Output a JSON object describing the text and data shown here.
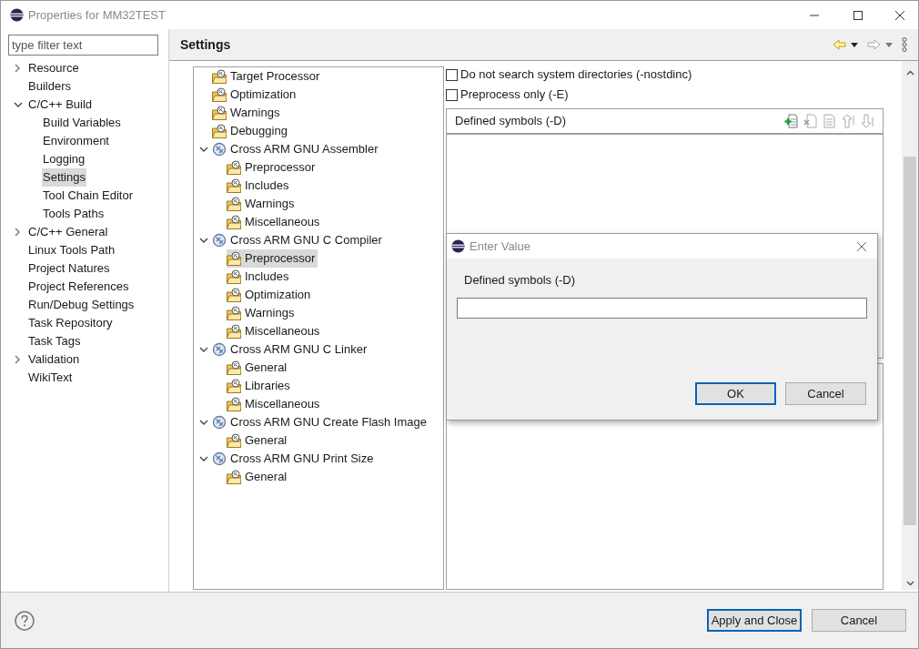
{
  "window": {
    "title": "Properties for MM32TEST"
  },
  "filter": {
    "placeholder": "type filter text"
  },
  "nav": [
    {
      "label": "Resource",
      "expanded": false,
      "selected": false
    },
    {
      "label": "Builders",
      "selected": false
    },
    {
      "label": "C/C++ Build",
      "expanded": true,
      "selected": false,
      "children": [
        {
          "label": "Build Variables",
          "selected": false
        },
        {
          "label": "Environment",
          "selected": false
        },
        {
          "label": "Logging",
          "selected": false
        },
        {
          "label": "Settings",
          "selected": true
        },
        {
          "label": "Tool Chain Editor",
          "selected": false
        },
        {
          "label": "Tools Paths",
          "selected": false
        }
      ]
    },
    {
      "label": "C/C++ General",
      "expanded": false,
      "selected": false
    },
    {
      "label": "Linux Tools Path",
      "selected": false
    },
    {
      "label": "Project Natures",
      "selected": false
    },
    {
      "label": "Project References",
      "selected": false
    },
    {
      "label": "Run/Debug Settings",
      "selected": false
    },
    {
      "label": "Task Repository",
      "selected": false
    },
    {
      "label": "Task Tags",
      "selected": false
    },
    {
      "label": "Validation",
      "expanded": false,
      "selected": false
    },
    {
      "label": "WikiText",
      "selected": false
    }
  ],
  "page_title": "Settings",
  "tool_tree": [
    {
      "label": "Target Processor",
      "kind": "category",
      "selected": false
    },
    {
      "label": "Optimization",
      "kind": "category",
      "selected": false
    },
    {
      "label": "Warnings",
      "kind": "category",
      "selected": false
    },
    {
      "label": "Debugging",
      "kind": "category",
      "selected": false
    },
    {
      "label": "Cross ARM GNU Assembler",
      "kind": "tool",
      "expanded": true,
      "selected": false,
      "children": [
        {
          "label": "Preprocessor",
          "kind": "category",
          "selected": false
        },
        {
          "label": "Includes",
          "kind": "category",
          "selected": false
        },
        {
          "label": "Warnings",
          "kind": "category",
          "selected": false
        },
        {
          "label": "Miscellaneous",
          "kind": "category",
          "selected": false
        }
      ]
    },
    {
      "label": "Cross ARM GNU C Compiler",
      "kind": "tool",
      "expanded": true,
      "selected": false,
      "children": [
        {
          "label": "Preprocessor",
          "kind": "category",
          "selected": true
        },
        {
          "label": "Includes",
          "kind": "category",
          "selected": false
        },
        {
          "label": "Optimization",
          "kind": "category",
          "selected": false
        },
        {
          "label": "Warnings",
          "kind": "category",
          "selected": false
        },
        {
          "label": "Miscellaneous",
          "kind": "category",
          "selected": false
        }
      ]
    },
    {
      "label": "Cross ARM GNU C Linker",
      "kind": "tool",
      "expanded": true,
      "selected": false,
      "children": [
        {
          "label": "General",
          "kind": "category",
          "selected": false
        },
        {
          "label": "Libraries",
          "kind": "category",
          "selected": false
        },
        {
          "label": "Miscellaneous",
          "kind": "category",
          "selected": false
        }
      ]
    },
    {
      "label": "Cross ARM GNU Create Flash Image",
      "kind": "tool",
      "expanded": true,
      "selected": false,
      "children": [
        {
          "label": "General",
          "kind": "category",
          "selected": false
        }
      ]
    },
    {
      "label": "Cross ARM GNU Print Size",
      "kind": "tool",
      "expanded": true,
      "selected": false,
      "children": [
        {
          "label": "General",
          "kind": "category",
          "selected": false
        }
      ]
    }
  ],
  "options": [
    {
      "label": "Do not search system directories (-nostdinc)",
      "checked": false
    },
    {
      "label": "Preprocess only (-E)",
      "checked": false
    }
  ],
  "symbols_panel": {
    "title": "Defined symbols (-D)"
  },
  "dialog": {
    "title": "Enter Value",
    "label": "Defined symbols (-D)",
    "buttons": [
      {
        "label": "OK",
        "default": true
      },
      {
        "label": "Cancel",
        "default": false
      }
    ]
  },
  "footer": {
    "buttons": [
      {
        "label": "Apply and Close",
        "default": true
      },
      {
        "label": "Cancel",
        "default": false
      }
    ]
  }
}
